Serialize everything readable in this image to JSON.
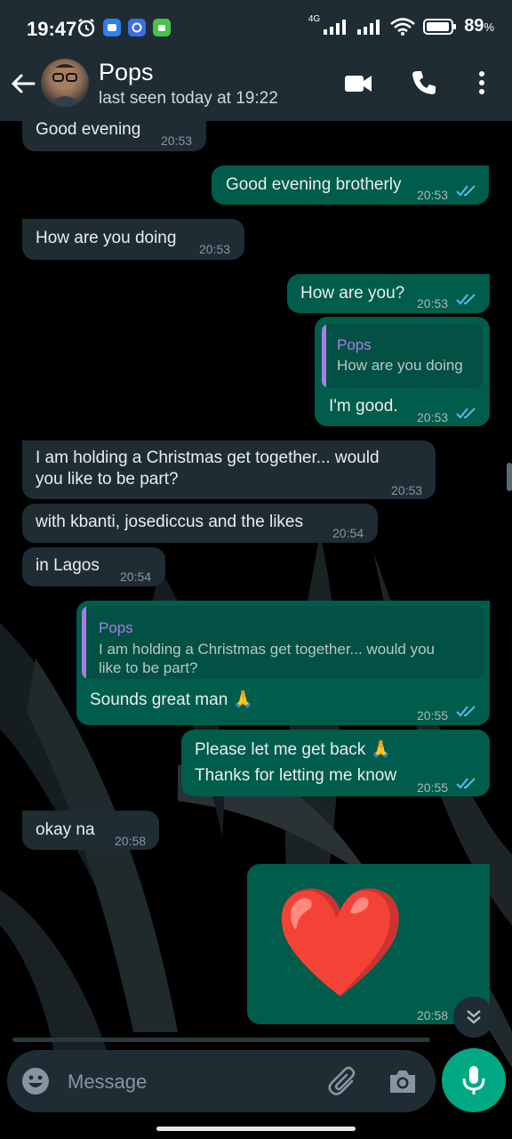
{
  "status_bar": {
    "time": "19:47",
    "network": "4G",
    "battery": "89",
    "battery_unit": "%"
  },
  "header": {
    "name": "Pops",
    "status": "last seen today at 19:22"
  },
  "messages": [
    {
      "dir": "in",
      "text": "Good evening",
      "time": "20:53"
    },
    {
      "dir": "out",
      "text": "Good evening brotherly",
      "time": "20:53",
      "read": true
    },
    {
      "dir": "in",
      "text": "How are you doing",
      "time": "20:53"
    },
    {
      "dir": "out",
      "text": "How are you?",
      "time": "20:53",
      "read": true
    },
    {
      "dir": "out",
      "quote": {
        "name": "Pops",
        "text": "How are you doing"
      },
      "text": "I'm good.",
      "time": "20:53",
      "read": true
    },
    {
      "dir": "in",
      "text": "I am holding a Christmas get together... would you like to be part?",
      "line1": "I am holding a Christmas get together... would",
      "line2": "you like to be part?",
      "time": "20:53"
    },
    {
      "dir": "in",
      "text": "with kbanti, josediccus and the likes",
      "time": "20:54"
    },
    {
      "dir": "in",
      "text": "in Lagos",
      "time": "20:54"
    },
    {
      "dir": "out",
      "quote": {
        "name": "Pops",
        "text": "I am holding a Christmas get together... would you like to be part?",
        "line1": "I am holding a Christmas get together... would you",
        "line2": "like to be part?"
      },
      "text": "Sounds great man 🙏",
      "time": "20:55",
      "read": true
    },
    {
      "dir": "out",
      "text": "Please let me get back 🙏 Thanks for letting me know",
      "line1": "Please let me get back 🙏",
      "line2": "Thanks for letting me know",
      "time": "20:55",
      "read": true
    },
    {
      "dir": "in",
      "text": "okay na",
      "time": "20:58"
    },
    {
      "dir": "out",
      "text": "❤️",
      "time": "20:58"
    }
  ],
  "composer": {
    "placeholder": "Message"
  },
  "colors": {
    "header": "#1f2c34",
    "incoming": "#1f2c34",
    "outgoing": "#005c4b",
    "accent": "#00a884",
    "read_tick": "#53bdeb",
    "quote_name": "#a67de8"
  },
  "icons": [
    "back-arrow-icon",
    "video-call-icon",
    "phone-icon",
    "more-vert-icon",
    "emoji-icon",
    "attach-icon",
    "camera-icon",
    "mic-icon",
    "double-chevron-down-icon"
  ]
}
